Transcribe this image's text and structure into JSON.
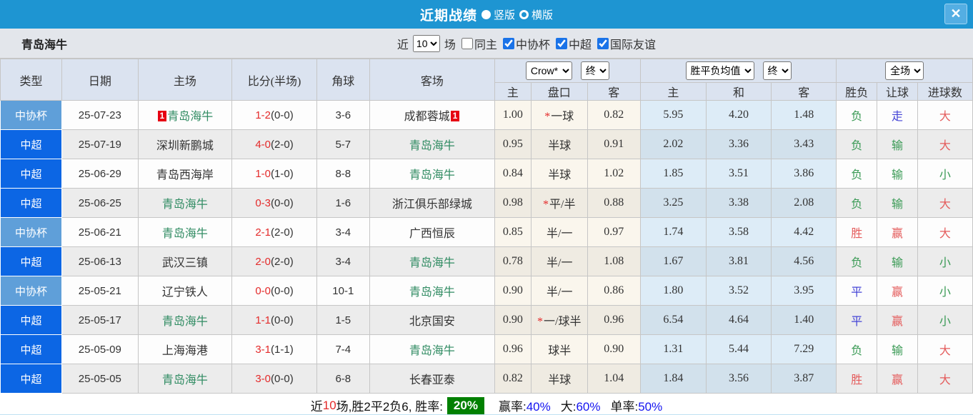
{
  "titlebar": {
    "title": "近期战绩",
    "view_options": [
      {
        "label": "竖版",
        "selected": true
      },
      {
        "label": "横版",
        "selected": false
      }
    ],
    "close_label": "✕"
  },
  "filterbar": {
    "team_name": "青岛海牛",
    "near_label": "近",
    "match_count": "10",
    "games_label": "场",
    "same_home": {
      "label": "同主",
      "checked": false
    },
    "league_filters": [
      {
        "label": "中协杯",
        "checked": true
      },
      {
        "label": "中超",
        "checked": true
      },
      {
        "label": "国际友谊",
        "checked": true
      }
    ]
  },
  "table": {
    "columns": [
      "类型",
      "日期",
      "主场",
      "比分(半场)",
      "角球",
      "客场"
    ],
    "sub_columns": [
      "主",
      "盘口",
      "客",
      "主",
      "和",
      "客",
      "胜负",
      "让球",
      "进球数"
    ],
    "selects": {
      "company": "Crow*",
      "company_time": "终",
      "avg": "胜平负均值",
      "avg_time": "终",
      "scope": "全场"
    },
    "rows": [
      {
        "type": "中协杯",
        "type_class": "cup",
        "date": "25-07-23",
        "home": "青岛海牛",
        "home_self": true,
        "home_badge": "1",
        "score": "1-2",
        "half": "(0-0)",
        "corners": "3-6",
        "away": "成都蓉城",
        "away_self": false,
        "away_badge": "1",
        "h_home": "1.00",
        "h_star": true,
        "h_line": "一球",
        "h_away": "0.82",
        "a_home": "5.95",
        "a_draw": "4.20",
        "a_away": "1.48",
        "r_wdl": {
          "t": "负",
          "c": "g"
        },
        "r_handicap": {
          "t": "走",
          "c": "b"
        },
        "r_goals": {
          "t": "大",
          "c": "r"
        }
      },
      {
        "type": "中超",
        "type_class": "league",
        "date": "25-07-19",
        "home": "深圳新鹏城",
        "home_self": false,
        "home_badge": "",
        "score": "4-0",
        "half": "(2-0)",
        "corners": "5-7",
        "away": "青岛海牛",
        "away_self": true,
        "away_badge": "",
        "h_home": "0.95",
        "h_star": false,
        "h_line": "半球",
        "h_away": "0.91",
        "a_home": "2.02",
        "a_draw": "3.36",
        "a_away": "3.43",
        "r_wdl": {
          "t": "负",
          "c": "g"
        },
        "r_handicap": {
          "t": "输",
          "c": "g"
        },
        "r_goals": {
          "t": "大",
          "c": "r"
        }
      },
      {
        "type": "中超",
        "type_class": "league",
        "date": "25-06-29",
        "home": "青岛西海岸",
        "home_self": false,
        "home_badge": "",
        "score": "1-0",
        "half": "(1-0)",
        "corners": "8-8",
        "away": "青岛海牛",
        "away_self": true,
        "away_badge": "",
        "h_home": "0.84",
        "h_star": false,
        "h_line": "半球",
        "h_away": "1.02",
        "a_home": "1.85",
        "a_draw": "3.51",
        "a_away": "3.86",
        "r_wdl": {
          "t": "负",
          "c": "g"
        },
        "r_handicap": {
          "t": "输",
          "c": "g"
        },
        "r_goals": {
          "t": "小",
          "c": "g"
        }
      },
      {
        "type": "中超",
        "type_class": "league",
        "date": "25-06-25",
        "home": "青岛海牛",
        "home_self": true,
        "home_badge": "",
        "score": "0-3",
        "half": "(0-0)",
        "corners": "1-6",
        "away": "浙江俱乐部绿城",
        "away_self": false,
        "away_badge": "",
        "h_home": "0.98",
        "h_star": true,
        "h_line": "平/半",
        "h_away": "0.88",
        "a_home": "3.25",
        "a_draw": "3.38",
        "a_away": "2.08",
        "r_wdl": {
          "t": "负",
          "c": "g"
        },
        "r_handicap": {
          "t": "输",
          "c": "g"
        },
        "r_goals": {
          "t": "大",
          "c": "r"
        }
      },
      {
        "type": "中协杯",
        "type_class": "cup",
        "date": "25-06-21",
        "home": "青岛海牛",
        "home_self": true,
        "home_badge": "",
        "score": "2-1",
        "half": "(2-0)",
        "corners": "3-4",
        "away": "广西恒辰",
        "away_self": false,
        "away_badge": "",
        "h_home": "0.85",
        "h_star": false,
        "h_line": "半/一",
        "h_away": "0.97",
        "a_home": "1.74",
        "a_draw": "3.58",
        "a_away": "4.42",
        "r_wdl": {
          "t": "胜",
          "c": "r"
        },
        "r_handicap": {
          "t": "赢",
          "c": "r"
        },
        "r_goals": {
          "t": "大",
          "c": "r"
        }
      },
      {
        "type": "中超",
        "type_class": "league",
        "date": "25-06-13",
        "home": "武汉三镇",
        "home_self": false,
        "home_badge": "",
        "score": "2-0",
        "half": "(2-0)",
        "corners": "3-4",
        "away": "青岛海牛",
        "away_self": true,
        "away_badge": "",
        "h_home": "0.78",
        "h_star": false,
        "h_line": "半/一",
        "h_away": "1.08",
        "a_home": "1.67",
        "a_draw": "3.81",
        "a_away": "4.56",
        "r_wdl": {
          "t": "负",
          "c": "g"
        },
        "r_handicap": {
          "t": "输",
          "c": "g"
        },
        "r_goals": {
          "t": "小",
          "c": "g"
        }
      },
      {
        "type": "中协杯",
        "type_class": "cup",
        "date": "25-05-21",
        "home": "辽宁铁人",
        "home_self": false,
        "home_badge": "",
        "score": "0-0",
        "half": "(0-0)",
        "corners": "10-1",
        "away": "青岛海牛",
        "away_self": true,
        "away_badge": "",
        "h_home": "0.90",
        "h_star": false,
        "h_line": "半/一",
        "h_away": "0.86",
        "a_home": "1.80",
        "a_draw": "3.52",
        "a_away": "3.95",
        "r_wdl": {
          "t": "平",
          "c": "b"
        },
        "r_handicap": {
          "t": "赢",
          "c": "r"
        },
        "r_goals": {
          "t": "小",
          "c": "g"
        }
      },
      {
        "type": "中超",
        "type_class": "league",
        "date": "25-05-17",
        "home": "青岛海牛",
        "home_self": true,
        "home_badge": "",
        "score": "1-1",
        "half": "(0-0)",
        "corners": "1-5",
        "away": "北京国安",
        "away_self": false,
        "away_badge": "",
        "h_home": "0.90",
        "h_star": true,
        "h_line": "一/球半",
        "h_away": "0.96",
        "a_home": "6.54",
        "a_draw": "4.64",
        "a_away": "1.40",
        "r_wdl": {
          "t": "平",
          "c": "b"
        },
        "r_handicap": {
          "t": "赢",
          "c": "r"
        },
        "r_goals": {
          "t": "小",
          "c": "g"
        }
      },
      {
        "type": "中超",
        "type_class": "league",
        "date": "25-05-09",
        "home": "上海海港",
        "home_self": false,
        "home_badge": "",
        "score": "3-1",
        "half": "(1-1)",
        "corners": "7-4",
        "away": "青岛海牛",
        "away_self": true,
        "away_badge": "",
        "h_home": "0.96",
        "h_star": false,
        "h_line": "球半",
        "h_away": "0.90",
        "a_home": "1.31",
        "a_draw": "5.44",
        "a_away": "7.29",
        "r_wdl": {
          "t": "负",
          "c": "g"
        },
        "r_handicap": {
          "t": "输",
          "c": "g"
        },
        "r_goals": {
          "t": "大",
          "c": "r"
        }
      },
      {
        "type": "中超",
        "type_class": "league",
        "date": "25-05-05",
        "home": "青岛海牛",
        "home_self": true,
        "home_badge": "",
        "score": "3-0",
        "half": "(0-0)",
        "corners": "6-8",
        "away": "长春亚泰",
        "away_self": false,
        "away_badge": "",
        "h_home": "0.82",
        "h_star": false,
        "h_line": "半球",
        "h_away": "1.04",
        "a_home": "1.84",
        "a_draw": "3.56",
        "a_away": "3.87",
        "r_wdl": {
          "t": "胜",
          "c": "r"
        },
        "r_handicap": {
          "t": "赢",
          "c": "r"
        },
        "r_goals": {
          "t": "大",
          "c": "r"
        }
      }
    ]
  },
  "footer": {
    "prefix": "近",
    "count": "10",
    "mid": "场,胜2平2负6, 胜率:",
    "win_rate": "20%",
    "stats": [
      {
        "label": "赢率:",
        "value": "40%"
      },
      {
        "label": "大:",
        "value": "60%"
      },
      {
        "label": "单率:",
        "value": "50%"
      }
    ]
  },
  "colors": {
    "titlebar_bg": "#1e95d2",
    "cup_bg": "#5f9fd9",
    "league_bg": "#0c66e4",
    "team_green": "#318c63",
    "score_red": "#e42a2a",
    "result_green": "#3a9a55",
    "result_red": "#e45c5c",
    "result_blue": "#4545d6",
    "rate_green_bg": "#018001",
    "percent_blue": "#1414f0",
    "badge_red": "#e60012",
    "checkbox_blue": "#1a73e8"
  }
}
